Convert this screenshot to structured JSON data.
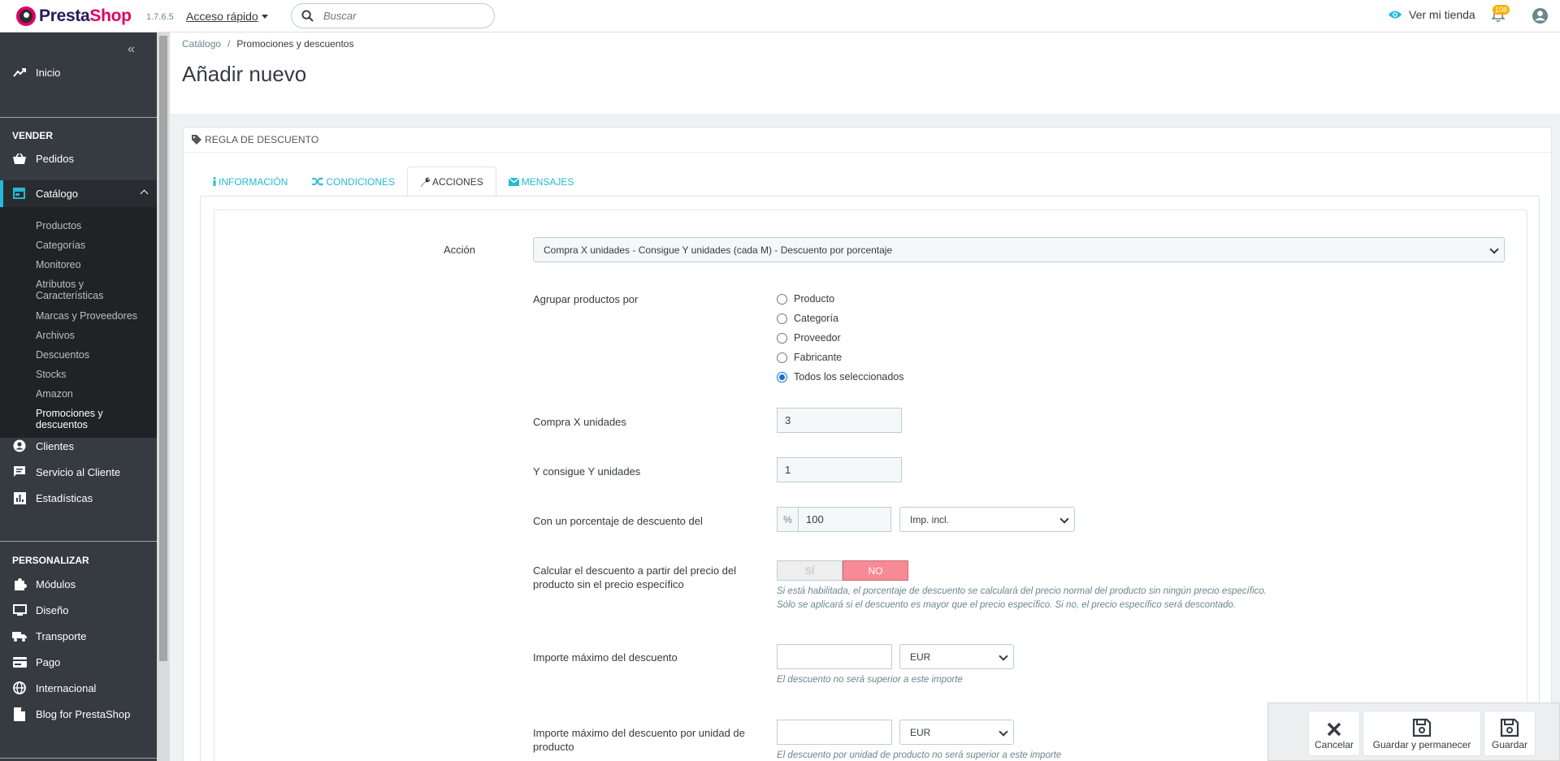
{
  "header": {
    "logo_pre": "Presta",
    "logo_shop": "Shop",
    "version": "1.7.6.5",
    "quick_access": "Acceso rápido",
    "search_placeholder": "Buscar",
    "view_shop": "Ver mi tienda",
    "notifications_count": "108"
  },
  "sidebar": {
    "home": "Inicio",
    "section_sell": "VENDER",
    "orders": "Pedidos",
    "catalog": "Catálogo",
    "catalog_sub": [
      "Productos",
      "Categorías",
      "Monitoreo",
      "Atributos y",
      "Características",
      "Marcas y Proveedores",
      "Archivos",
      "Descuentos",
      "Stocks",
      "Amazon",
      "Promociones y",
      "descuentos"
    ],
    "customers": "Clientes",
    "customer_service": "Servicio al Cliente",
    "stats": "Estadísticas",
    "section_customize": "PERSONALIZAR",
    "modules": "Módulos",
    "design": "Diseño",
    "shipping": "Transporte",
    "payment": "Pago",
    "international": "Internacional",
    "blog": "Blog for PrestaShop"
  },
  "breadcrumb": {
    "root": "Catálogo",
    "sep": "/",
    "current": "Promociones y descuentos"
  },
  "page_title": "Añadir nuevo",
  "panel": {
    "title": "REGLA DE DESCUENTO",
    "tabs": [
      "INFORMACIÓN",
      "CONDICIONES",
      "ACCIONES",
      "MENSAJES"
    ]
  },
  "form": {
    "action_label": "Acción",
    "action_value": "Compra X unidades - Consigue Y unidades (cada M) - Descuento por porcentaje",
    "group_label": "Agrupar productos por",
    "group_options": [
      "Producto",
      "Categoría",
      "Proveedor",
      "Fabricante",
      "Todos los seleccionados"
    ],
    "buy_x_label": "Compra X unidades",
    "buy_x_value": "3",
    "get_y_label": "Y consigue Y unidades",
    "get_y_value": "1",
    "percent_label": "Con un porcentaje de descuento del",
    "percent_addon": "%",
    "percent_value": "100",
    "tax_value": "Imp. incl.",
    "calc_label_1": "Calcular el descuento a partir del precio del",
    "calc_label_2": "producto sin el precio específico",
    "switch_yes": "SÍ",
    "switch_no": "NO",
    "calc_help_1": "Si está habilitada, el porcentaje de descuento se calculará del precio normal del producto sin ningún precio específico.",
    "calc_help_2": "Sólo se aplicará si el descuento es mayor que el precio específico. Si no, el precio específico será descontado.",
    "max_label": "Importe máximo del descuento",
    "max_currency": "EUR",
    "max_help": "El descuento no será superior a este importe",
    "max_unit_label_1": "Importe máximo del descuento por unidad de",
    "max_unit_label_2": "producto",
    "max_unit_currency": "EUR",
    "max_unit_help": "El descuento por unidad de producto no será superior a este importe"
  },
  "toolbar": {
    "cancel": "Cancelar",
    "save_stay": "Guardar y permanecer",
    "save": "Guardar"
  }
}
